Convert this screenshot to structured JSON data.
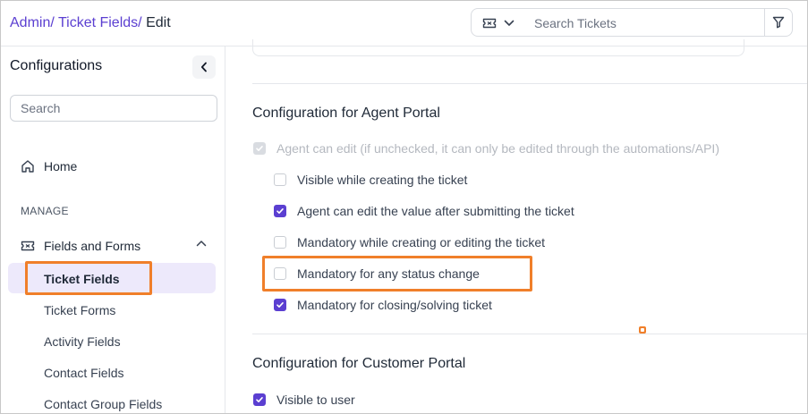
{
  "header": {
    "breadcrumb": {
      "admin": "Admin/",
      "ticket_fields": "Ticket Fields/",
      "current": "Edit"
    },
    "search": {
      "placeholder": "Search Tickets",
      "type_icon": "ticket-icon",
      "filter_icon": "filter-icon"
    }
  },
  "sidebar": {
    "title": "Configurations",
    "search_placeholder": "Search",
    "home_label": "Home",
    "section_label": "MANAGE",
    "group_label": "Fields and Forms",
    "items": [
      {
        "label": "Ticket Fields",
        "active": true
      },
      {
        "label": "Ticket Forms",
        "active": false
      },
      {
        "label": "Activity Fields",
        "active": false
      },
      {
        "label": "Contact Fields",
        "active": false
      },
      {
        "label": "Contact Group Fields",
        "active": false
      }
    ]
  },
  "main": {
    "agent_portal": {
      "title": "Configuration for Agent Portal",
      "master_option": {
        "label": "Agent can edit (if unchecked, it can only be edited through the automations/API)",
        "checked": true,
        "disabled": true
      },
      "options": [
        {
          "label": "Visible while creating the ticket",
          "checked": false
        },
        {
          "label": "Agent can edit the value after submitting the ticket",
          "checked": true
        },
        {
          "label": "Mandatory while creating or editing the ticket",
          "checked": false
        },
        {
          "label": "Mandatory for any status change",
          "checked": false,
          "highlighted": true
        },
        {
          "label": "Mandatory for closing/solving ticket",
          "checked": true
        }
      ]
    },
    "customer_portal": {
      "title": "Configuration for Customer Portal",
      "options": [
        {
          "label": "Visible to user",
          "checked": true
        }
      ]
    }
  },
  "colors": {
    "accent": "#5b3fd1",
    "highlight": "#f07f2a",
    "active_bg": "#ede9fb"
  }
}
